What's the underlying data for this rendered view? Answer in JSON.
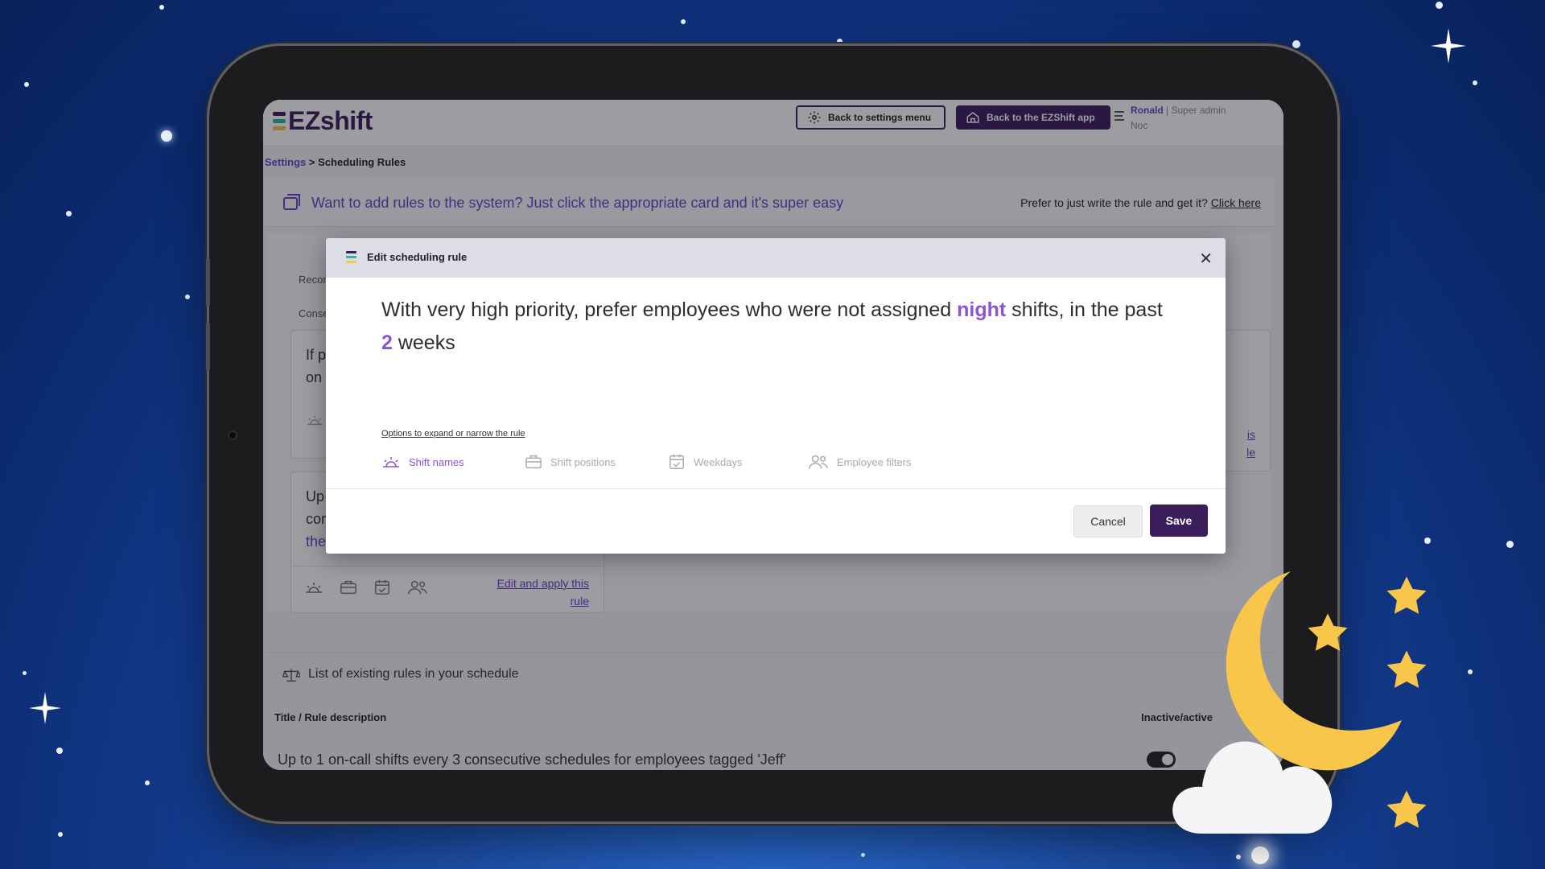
{
  "header": {
    "logo_text": "EZshift",
    "back_settings_label": "Back to settings menu",
    "back_app_label": "Back to the EZShift app",
    "user_name": "Ronald",
    "user_role": "Super admin",
    "user_org": "Noc"
  },
  "breadcrumb": {
    "parent": "Settings",
    "separator": ">",
    "current": "Scheduling Rules"
  },
  "promo": {
    "text": "Want to add rules to the system? Just click the appropriate card and it's super easy",
    "prefer_text": "Prefer to just write the rule and get it?",
    "click_here": "Click here"
  },
  "background_panel": {
    "section_label_1": "Recon",
    "section_label_2": "Conse",
    "card1_line1": "If p",
    "card1_line2": "on",
    "card2_line1": "Up",
    "card2_line2": "cor",
    "card2_line3": "the",
    "card2_edit_line1": "Edit and apply this",
    "card2_edit_line2": "rule",
    "card_right_edit_1": "is",
    "card_right_edit_2": "le"
  },
  "rules_list": {
    "title": "List of existing rules in your schedule",
    "col_title": "Title / Rule description",
    "col_status": "Inactive/active",
    "rows": [
      {
        "text": "Up to 1 on-call shifts every 3 consecutive schedules for employees tagged 'Jeff'",
        "active": true
      }
    ]
  },
  "modal": {
    "title": "Edit scheduling rule",
    "rule_part1": "With very high priority, prefer employees who were not assigned ",
    "rule_hl1": "night",
    "rule_part2": " shifts, in the past ",
    "rule_hl2": "2",
    "rule_part3": " weeks",
    "options_link": "Options to expand or narrow the rule",
    "options": [
      {
        "label": "Shift names",
        "icon": "sunrise-icon",
        "active": true
      },
      {
        "label": "Shift positions",
        "icon": "briefcase-icon",
        "active": false
      },
      {
        "label": "Weekdays",
        "icon": "calendar-check-icon",
        "active": false
      },
      {
        "label": "Employee filters",
        "icon": "users-icon",
        "active": false
      }
    ],
    "cancel_label": "Cancel",
    "save_label": "Save"
  },
  "colors": {
    "brand": "#3b1d5c",
    "accent": "#8a55d6",
    "link": "#6a43c7",
    "moon": "#f7c64a",
    "sky": "#123a8a"
  }
}
